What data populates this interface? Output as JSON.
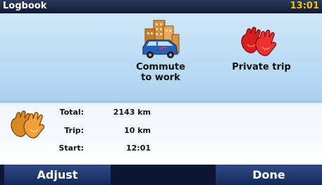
{
  "titlebar": {
    "title": "Logbook",
    "clock": "13:01"
  },
  "options": {
    "commute": {
      "label_line1": "Commute",
      "label_line2": "to work",
      "icon": "city-van-icon"
    },
    "private": {
      "label": "Private trip",
      "icon": "red-gloves-icon"
    }
  },
  "stats": {
    "icon": "orange-gloves-icon",
    "rows": [
      {
        "label": "Total:",
        "value": "2143 km"
      },
      {
        "label": "Trip:",
        "value": "10 km"
      },
      {
        "label": "Start:",
        "value": "12:01"
      }
    ]
  },
  "buttons": {
    "adjust": "Adjust",
    "done": "Done"
  },
  "colors": {
    "clock": "#f2c500",
    "button": "#1f3a74",
    "panel": "#bcdcf4"
  }
}
